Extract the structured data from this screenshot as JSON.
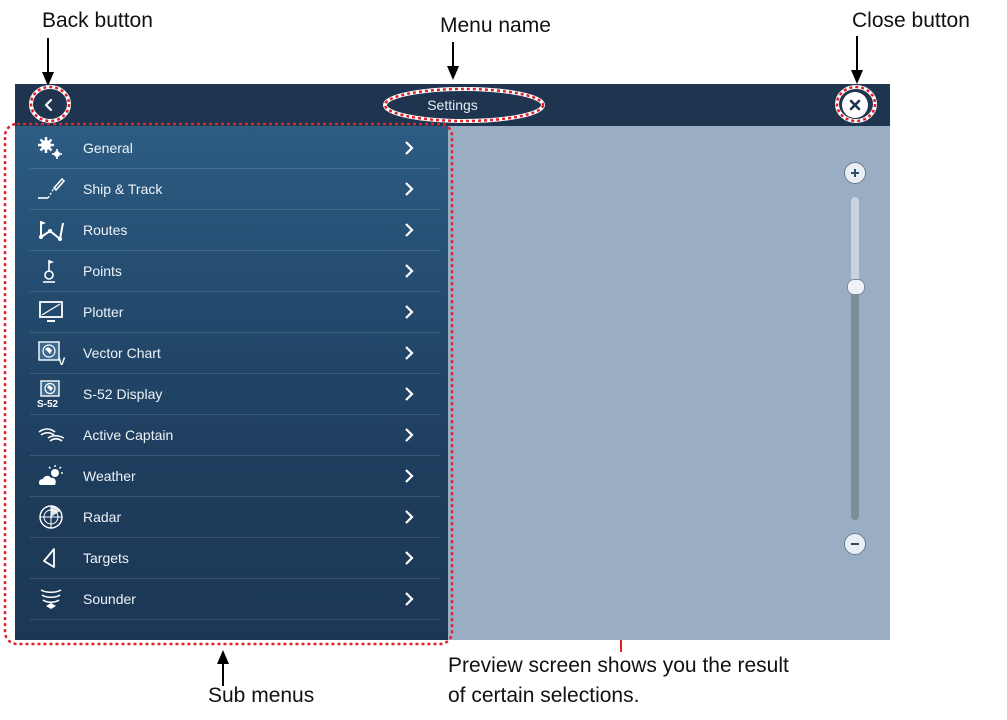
{
  "callouts": {
    "back": "Back button",
    "menu_name": "Menu name",
    "close": "Close button",
    "sub_menus": "Sub menus",
    "preview_line1": "Preview screen shows you the result",
    "preview_line2": "of certain selections."
  },
  "titlebar": {
    "title": "Settings"
  },
  "menu": {
    "items": [
      {
        "label": "General",
        "icon": "gears-icon"
      },
      {
        "label": "Ship & Track",
        "icon": "ship-track-icon"
      },
      {
        "label": "Routes",
        "icon": "routes-icon"
      },
      {
        "label": "Points",
        "icon": "points-icon"
      },
      {
        "label": "Plotter",
        "icon": "plotter-icon"
      },
      {
        "label": "Vector Chart",
        "icon": "vector-chart-icon"
      },
      {
        "label": "S-52 Display",
        "icon": "s52-display-icon"
      },
      {
        "label": "Active Captain",
        "icon": "active-captain-icon"
      },
      {
        "label": "Weather",
        "icon": "weather-icon"
      },
      {
        "label": "Radar",
        "icon": "radar-icon"
      },
      {
        "label": "Targets",
        "icon": "targets-icon"
      },
      {
        "label": "Sounder",
        "icon": "sounder-icon"
      }
    ],
    "s52_icon_text": "S-52"
  },
  "colors": {
    "titlebar": "#1e344f",
    "menu_bg": "#234a6d",
    "preview_bg": "#99aec2",
    "annotation_red": "#e0202a",
    "arrow_red": "#e0202a"
  }
}
